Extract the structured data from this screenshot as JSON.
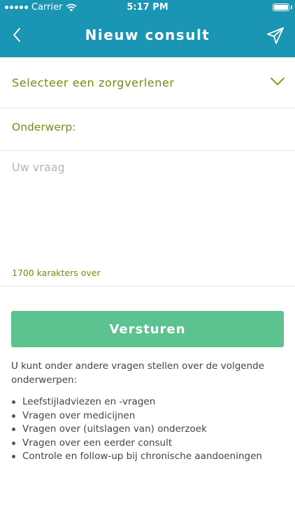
{
  "status_bar": {
    "carrier": "Carrier",
    "time": "5:17 PM"
  },
  "header": {
    "title": "Nieuw consult",
    "back_icon": "chevron-left-icon",
    "send_icon": "paper-plane-icon"
  },
  "form": {
    "provider_select_label": "Selecteer een zorgverlener",
    "subject_label": "Onderwerp:",
    "subject_value": "",
    "question_placeholder": "Uw vraag",
    "question_value": "",
    "char_counter": "1700 karakters over"
  },
  "submit": {
    "label": "Versturen"
  },
  "info": {
    "intro": "U kunt onder andere vragen stellen over de volgende onderwerpen:",
    "topics": [
      "Leefstijladviezen en -vragen",
      "Vragen over medicijnen",
      "Vragen over (uitslagen van) onderzoek",
      "Vragen over een eerder consult",
      "Controle en follow-up bij chronische aandoeningen"
    ]
  },
  "colors": {
    "header_bg": "#1a95b4",
    "accent_text": "#7a8a10",
    "button_bg": "#5cc290"
  }
}
